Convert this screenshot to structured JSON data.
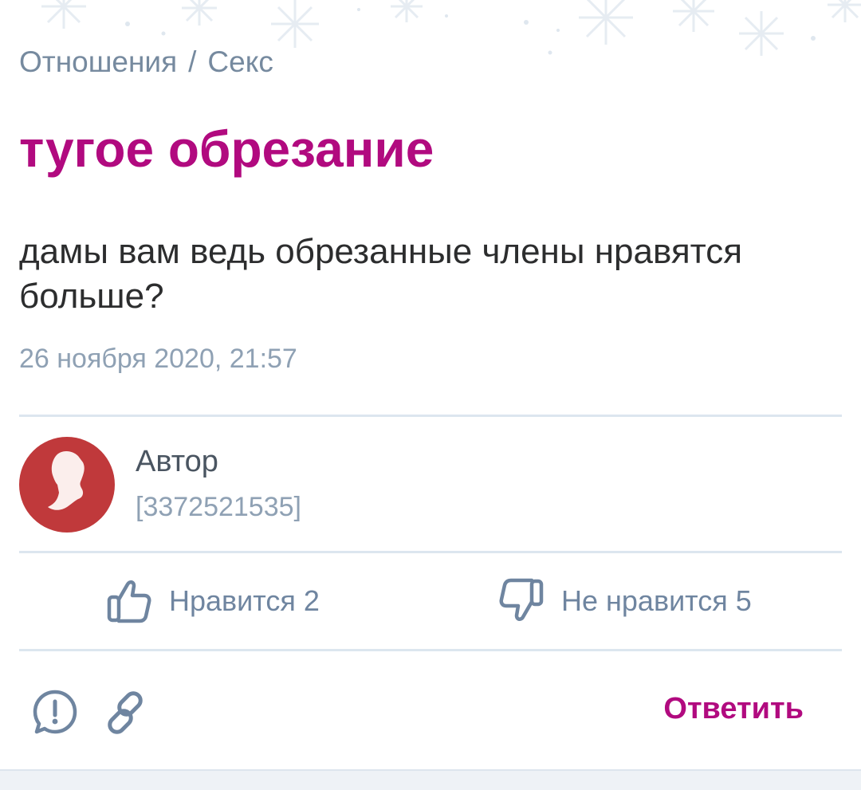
{
  "breadcrumb": {
    "items": [
      "Отношения",
      "Секс"
    ],
    "separator": "/"
  },
  "post": {
    "title": "тугое обрезание",
    "body": "дамы вам ведь обрезанные члены нравятся больше?",
    "date": "26 ноября 2020, 21:57"
  },
  "author": {
    "name": "Автор",
    "id": "[3372521535]",
    "avatar_icon": "user-silhouette-icon"
  },
  "reactions": {
    "like_label": "Нравится 2",
    "dislike_label": "Не нравится 5"
  },
  "actions": {
    "report_icon": "exclamation-circle-icon",
    "link_icon": "link-icon",
    "reply_label": "Ответить"
  },
  "colors": {
    "accent": "#b10a7f",
    "muted": "#768a9f",
    "avatar_bg": "#c0393b",
    "divider": "#dce6ef"
  }
}
